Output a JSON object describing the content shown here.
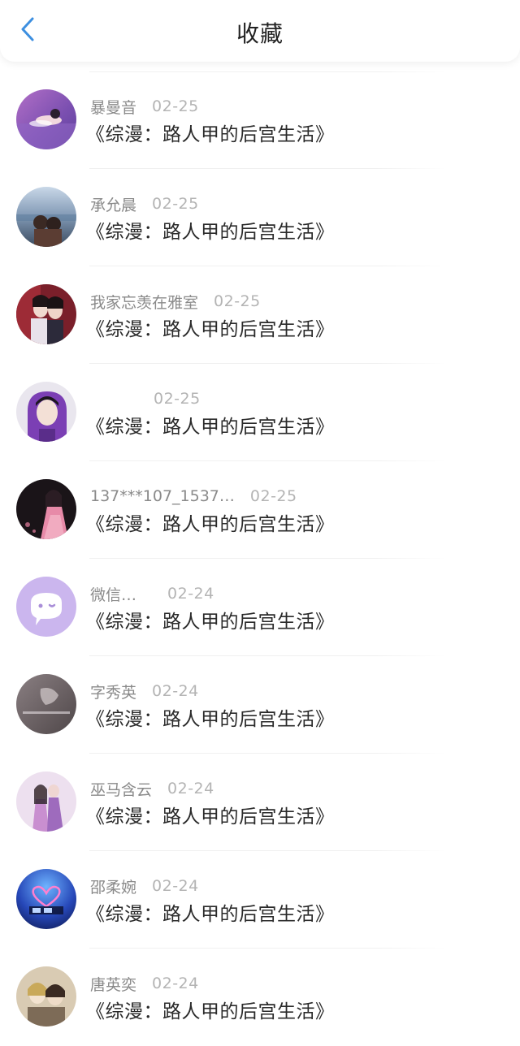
{
  "header": {
    "title": "收藏",
    "back_icon": "chevron-left-icon",
    "accent_color": "#3d8fe0"
  },
  "items": [
    {
      "name": "暴曼音",
      "date": "02-25",
      "title": "《综漫：路人甲的后宫生活》"
    },
    {
      "name": "承允晨",
      "date": "02-25",
      "title": "《综漫：路人甲的后宫生活》"
    },
    {
      "name": "我家忘羡在雅室",
      "date": "02-25",
      "title": "《综漫：路人甲的后宫生活》"
    },
    {
      "name": "",
      "date": "02-25",
      "title": "《综漫：路人甲的后宫生活》"
    },
    {
      "name": "137***107_1537…",
      "date": "02-25",
      "title": "《综漫：路人甲的后宫生活》"
    },
    {
      "name": "微信…",
      "date": "02-24",
      "title": "《综漫：路人甲的后宫生活》"
    },
    {
      "name": "字秀英",
      "date": "02-24",
      "title": "《综漫：路人甲的后宫生活》"
    },
    {
      "name": "巫马含云",
      "date": "02-24",
      "title": "《综漫：路人甲的后宫生活》"
    },
    {
      "name": "邵柔婉",
      "date": "02-24",
      "title": "《综漫：路人甲的后宫生活》"
    },
    {
      "name": "唐英奕",
      "date": "02-24",
      "title": "《综漫：路人甲的后宫生活》"
    }
  ]
}
